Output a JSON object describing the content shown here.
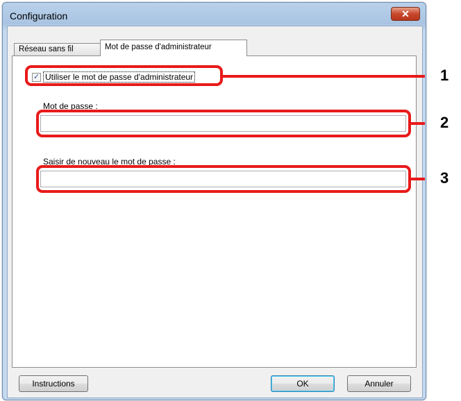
{
  "window": {
    "title": "Configuration",
    "close_glyph": "✕"
  },
  "tabs": [
    {
      "label": "Réseau sans fil"
    },
    {
      "label": "Mot de passe d'administrateur"
    }
  ],
  "checkbox": {
    "label": "Utiliser le mot de passe d'administrateur",
    "checked": true,
    "check_glyph": "✓"
  },
  "password": {
    "label": "Mot de passe :",
    "value": ""
  },
  "confirm": {
    "label": "Saisir de nouveau le mot de passe :",
    "value": ""
  },
  "callouts": [
    "1",
    "2",
    "3"
  ],
  "buttons": {
    "instructions": "Instructions",
    "ok": "OK",
    "cancel": "Annuler"
  },
  "colors": {
    "highlight": "#e81a1a",
    "close_button": "#c7482c"
  }
}
